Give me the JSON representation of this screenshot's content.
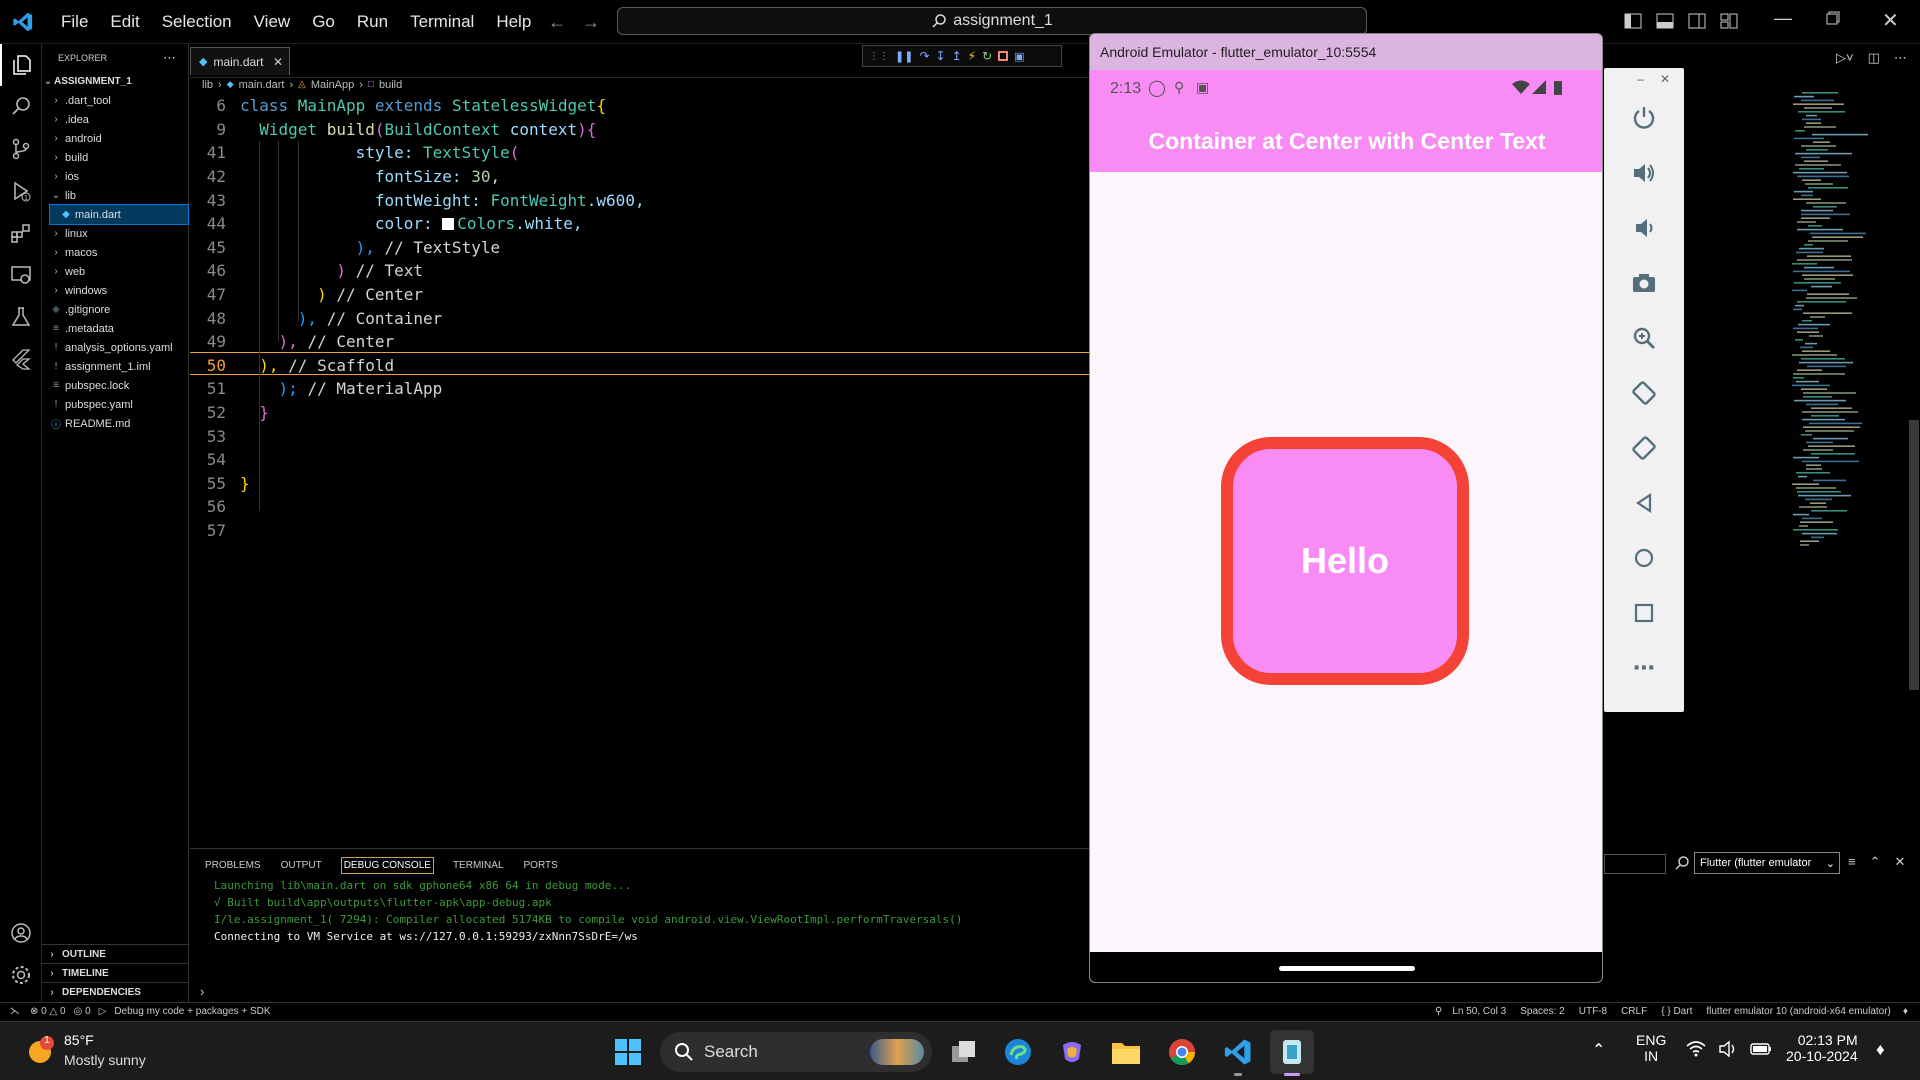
{
  "titlebar": {
    "menus": [
      "File",
      "Edit",
      "Selection",
      "View",
      "Go",
      "Run",
      "Terminal",
      "Help"
    ],
    "search_text": "assignment_1"
  },
  "explorer": {
    "header": "EXPLORER",
    "root": "ASSIGNMENT_1",
    "items": [
      {
        "label": ".dart_tool",
        "type": "folder"
      },
      {
        "label": ".idea",
        "type": "folder"
      },
      {
        "label": "android",
        "type": "folder"
      },
      {
        "label": "build",
        "type": "folder"
      },
      {
        "label": "ios",
        "type": "folder"
      },
      {
        "label": "lib",
        "type": "folder-open"
      },
      {
        "label": "main.dart",
        "type": "dart"
      },
      {
        "label": "linux",
        "type": "folder"
      },
      {
        "label": "macos",
        "type": "folder"
      },
      {
        "label": "web",
        "type": "folder"
      },
      {
        "label": "windows",
        "type": "folder"
      },
      {
        "label": ".gitignore",
        "type": "git"
      },
      {
        "label": ".metadata",
        "type": "meta"
      },
      {
        "label": "analysis_options.yaml",
        "type": "yaml"
      },
      {
        "label": "assignment_1.iml",
        "type": "iml"
      },
      {
        "label": "pubspec.lock",
        "type": "lock"
      },
      {
        "label": "pubspec.yaml",
        "type": "yaml"
      },
      {
        "label": "README.md",
        "type": "info"
      }
    ],
    "sections": [
      "OUTLINE",
      "TIMELINE",
      "DEPENDENCIES"
    ]
  },
  "editor": {
    "tab": "main.dart",
    "breadcrumb": [
      "lib",
      "main.dart",
      "MainApp",
      "build"
    ],
    "lines": [
      {
        "n": "6"
      },
      {
        "n": "9"
      },
      {
        "n": "41"
      },
      {
        "n": "42"
      },
      {
        "n": "43"
      },
      {
        "n": "44"
      },
      {
        "n": "45"
      },
      {
        "n": "46"
      },
      {
        "n": "47"
      },
      {
        "n": "48"
      },
      {
        "n": "49"
      },
      {
        "n": "50"
      },
      {
        "n": "51"
      },
      {
        "n": "52"
      },
      {
        "n": "53"
      },
      {
        "n": "54"
      },
      {
        "n": "55"
      },
      {
        "n": "56"
      },
      {
        "n": "57"
      }
    ],
    "code": {
      "l6a": "class ",
      "l6b": "MainApp",
      "l6c": " extends ",
      "l6d": "StatelessWidget",
      "l6e": "{",
      "l9a": "Widget ",
      "l9b": "build",
      "l9c": "(",
      "l9d": "BuildContext",
      "l9e": " context",
      "l9f": "){",
      "l41a": "style: ",
      "l41b": "TextStyle",
      "l41c": "(",
      "l42a": "fontSize: ",
      "l42b": "30",
      "l43a": "fontWeight: ",
      "l43b": "FontWeight",
      "l43c": ".w600,",
      "l44a": "color: ",
      "l44b": "Colors",
      "l44c": ".white,",
      "l45a": "), ",
      "l45b": "// TextStyle",
      "l46a": ") ",
      "l46b": "// Text",
      "l47a": ") ",
      "l47b": "// Center",
      "l48a": "), ",
      "l48b": "// Container",
      "l49a": "), ",
      "l49b": "// Center",
      "l50a": "), ",
      "l50b": "// Scaffold",
      "l51a": "); ",
      "l51b": "// MaterialApp",
      "l52a": "}",
      "l55a": "}"
    }
  },
  "panel": {
    "tabs": [
      "PROBLEMS",
      "OUTPUT",
      "DEBUG CONSOLE",
      "TERMINAL",
      "PORTS"
    ],
    "active_tab": "DEBUG CONSOLE",
    "logs": [
      "Launching lib\\main.dart on sdk gphone64 x86 64 in debug mode...",
      "√ Built build\\app\\outputs\\flutter-apk\\app-debug.apk",
      "I/le.assignment_1( 7294): Compiler allocated 5174KB to compile void android.view.ViewRootImpl.performTraversals()",
      "Connecting to VM Service at ws://127.0.0.1:59293/zxNnn7SsDrE=/ws"
    ],
    "filter_select": "Flutter (flutter emulator"
  },
  "statusbar": {
    "errors": "0",
    "warnings": "0",
    "ports": "0",
    "debug": "Debug my code + packages + SDK",
    "position": "Ln 50, Col 3",
    "spaces": "Spaces: 2",
    "encoding": "UTF-8",
    "eol": "CRLF",
    "language": "Dart",
    "device": "flutter emulator 10 (android-x64 emulator)"
  },
  "emulator": {
    "window_title": "Android Emulator - flutter_emulator_10:5554",
    "time": "2:13",
    "appbar_title": "Container at Center with Center Text",
    "container_text": "Hello"
  },
  "taskbar": {
    "weather_temp": "85°F",
    "weather_desc": "Mostly sunny",
    "weather_badge": "1",
    "search": "Search",
    "lang1": "ENG",
    "lang2": "IN",
    "clock_time": "02:13 PM",
    "clock_date": "20-10-2024"
  },
  "colors": {
    "app_pink": "#f98cf4",
    "container_border": "#f44336",
    "emu_title": "#dcb4e0"
  }
}
